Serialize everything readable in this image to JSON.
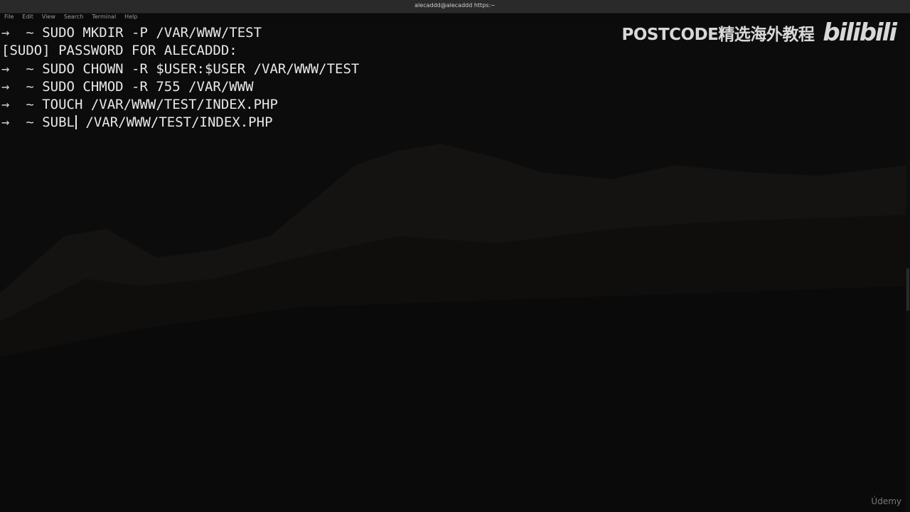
{
  "window": {
    "title": "alecaddd@alecaddd https:~"
  },
  "menu": [
    "File",
    "Edit",
    "View",
    "Search",
    "Terminal",
    "Help"
  ],
  "terminal": {
    "lines": [
      {
        "prompt": "→  ~ ",
        "text": "SUDO MKDIR -P /VAR/WWW/TEST"
      },
      {
        "prompt": "",
        "text": "[SUDO] PASSWORD FOR ALECADDD:"
      },
      {
        "prompt": "→  ~ ",
        "text": "SUDO CHOWN -R $USER:$USER /VAR/WWW/TEST"
      },
      {
        "prompt": "→  ~ ",
        "text": "SUDO CHMOD -R 755 /VAR/WWW"
      },
      {
        "prompt": "→  ~ ",
        "text": "TOUCH /VAR/WWW/TEST/INDEX.PHP"
      },
      {
        "prompt": "→  ~ ",
        "text_before_cursor": "SUBL",
        "text_after_cursor": " /VAR/WWW/TEST/INDEX.PHP"
      }
    ]
  },
  "watermark": {
    "text": "POSTCODE精选海外教程",
    "logo": "bilibili"
  },
  "corner_mark": "Údemy"
}
